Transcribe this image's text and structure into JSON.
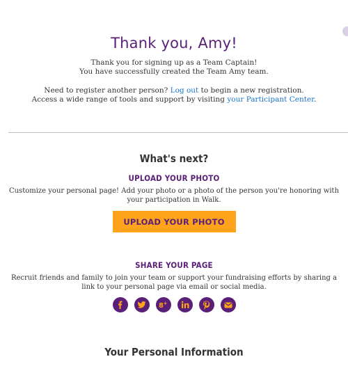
{
  "header": {
    "title": "Thank you, Amy!",
    "thanks_line1": "Thank you for signing up as a Team Captain!",
    "thanks_line2": "You have successfully created the Team Amy team.",
    "register_prefix": "Need to register another person?",
    "logout_link": "Log out",
    "register_suffix": "to begin a new registration.",
    "access_prefix": "Access a wide range of tools and support by visiting",
    "participant_center_link": "your Participant Center",
    "access_suffix": "."
  },
  "whats_next": {
    "heading": "What's next?",
    "upload": {
      "heading": "UPLOAD YOUR PHOTO",
      "description": "Customize your personal page! Add your photo or a photo of the person you're honoring with your participation in Walk.",
      "button_label": "UPLOAD YOUR PHOTO"
    },
    "share": {
      "heading": "SHARE YOUR PAGE",
      "description": "Recruit friends and family to join your team or support your fundraising efforts by sharing a link to your personal page via email or social media.",
      "icons": [
        "facebook-icon",
        "twitter-icon",
        "google-plus-icon",
        "linkedin-icon",
        "pinterest-icon",
        "email-icon"
      ]
    }
  },
  "personal_info": {
    "heading": "Your Personal Information"
  },
  "colors": {
    "brand_purple": "#5a1f78",
    "accent_orange": "#ffa31a",
    "link_blue": "#1a73c8"
  }
}
